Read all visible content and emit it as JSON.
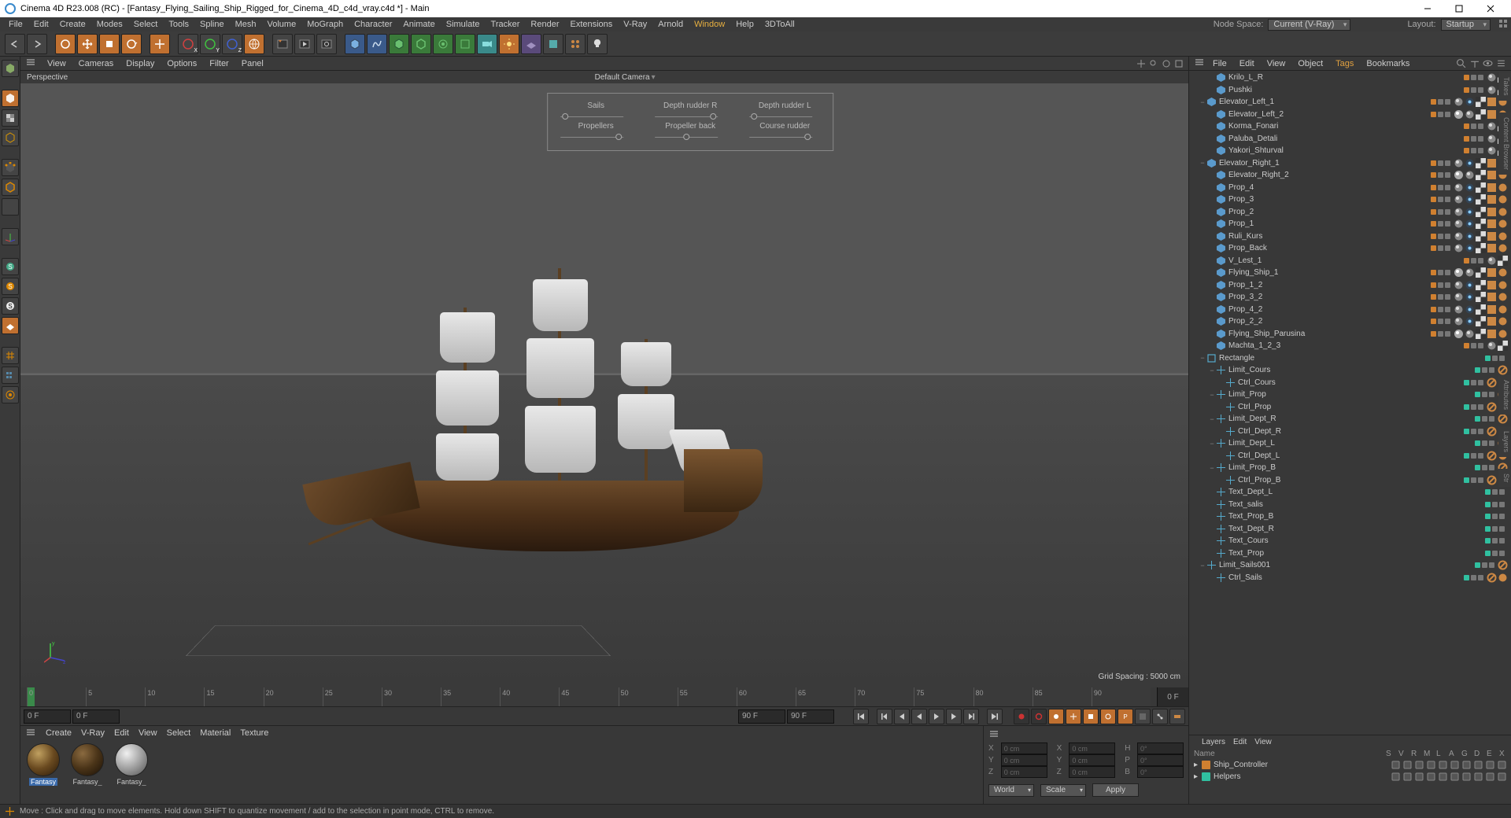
{
  "title": "Cinema 4D R23.008 (RC) - [Fantasy_Flying_Sailing_Ship_Rigged_for_Cinema_4D_c4d_vray.c4d *] - Main",
  "menu": [
    "File",
    "Edit",
    "Create",
    "Modes",
    "Select",
    "Tools",
    "Spline",
    "Mesh",
    "Volume",
    "MoGraph",
    "Character",
    "Animate",
    "Simulate",
    "Tracker",
    "Render",
    "Extensions",
    "V-Ray",
    "Arnold",
    "Window",
    "Help",
    "3DToAll"
  ],
  "menu_highlight": "Window",
  "node_space_label": "Node Space:",
  "node_space_value": "Current (V-Ray)",
  "layout_label": "Layout:",
  "layout_value": "Startup",
  "viewport_menu": [
    "View",
    "Cameras",
    "Display",
    "Options",
    "Filter",
    "Panel"
  ],
  "viewport_label": "Perspective",
  "default_camera": "Default Camera",
  "hud": {
    "row1": [
      "Sails",
      "Depth rudder R",
      "Depth rudder L"
    ],
    "row2": [
      "Propellers",
      "Propeller back",
      "Course rudder"
    ]
  },
  "grid_spacing": "Grid Spacing : 5000 cm",
  "timeline": {
    "start": 0,
    "end": 90,
    "step": 5,
    "current": "0 F",
    "total": "90 F"
  },
  "materials_menu": [
    "Create",
    "V-Ray",
    "Edit",
    "View",
    "Select",
    "Material",
    "Texture"
  ],
  "materials": [
    {
      "name": "Fantasy",
      "sel": true,
      "ball": "b1"
    },
    {
      "name": "Fantasy_",
      "sel": false,
      "ball": "b2"
    },
    {
      "name": "Fantasy_",
      "sel": false,
      "ball": "b3"
    }
  ],
  "coords": {
    "rows": [
      {
        "l1": "X",
        "v1": "0 cm",
        "l2": "X",
        "v2": "0 cm",
        "l3": "H",
        "v3": "0°"
      },
      {
        "l1": "Y",
        "v1": "0 cm",
        "l2": "Y",
        "v2": "0 cm",
        "l3": "P",
        "v3": "0°"
      },
      {
        "l1": "Z",
        "v1": "0 cm",
        "l2": "Z",
        "v2": "0 cm",
        "l3": "B",
        "v3": "0°"
      }
    ],
    "sys": "World",
    "mode": "Scale",
    "apply": "Apply"
  },
  "right_tabs": [
    "File",
    "Edit",
    "View",
    "Object",
    "Tags",
    "Bookmarks"
  ],
  "right_tabs_active": "Tags",
  "objects": [
    {
      "ind": 2,
      "exp": "",
      "icon": "poly",
      "name": "Krilo_L_R",
      "layer": "orange",
      "tags": [
        "phong",
        "checker"
      ]
    },
    {
      "ind": 2,
      "exp": "",
      "icon": "poly",
      "name": "Pushki",
      "layer": "orange",
      "tags": [
        "phong",
        "checker"
      ]
    },
    {
      "ind": 1,
      "exp": "−",
      "icon": "poly",
      "name": "Elevator_Left_1",
      "layer": "orange",
      "tags": [
        "phong",
        "vray",
        "checker",
        "uvw",
        "mat"
      ]
    },
    {
      "ind": 2,
      "exp": "",
      "icon": "poly",
      "name": "Elevator_Left_2",
      "layer": "orange",
      "tags": [
        "ball",
        "phong",
        "checker",
        "uvw",
        "mat"
      ]
    },
    {
      "ind": 2,
      "exp": "",
      "icon": "poly",
      "name": "Korma_Fonari",
      "layer": "orange",
      "tags": [
        "phong",
        "checker"
      ]
    },
    {
      "ind": 2,
      "exp": "",
      "icon": "poly",
      "name": "Paluba_Detali",
      "layer": "orange",
      "tags": [
        "phong",
        "checker"
      ]
    },
    {
      "ind": 2,
      "exp": "",
      "icon": "poly",
      "name": "Yakori_Shturval",
      "layer": "orange",
      "tags": [
        "phong",
        "checker"
      ]
    },
    {
      "ind": 1,
      "exp": "−",
      "icon": "poly",
      "name": "Elevator_Right_1",
      "layer": "orange",
      "tags": [
        "phong",
        "vray",
        "checker",
        "uvw",
        "mat"
      ]
    },
    {
      "ind": 2,
      "exp": "",
      "icon": "poly",
      "name": "Elevator_Right_2",
      "layer": "orange",
      "tags": [
        "ball",
        "phong",
        "checker",
        "uvw",
        "mat"
      ]
    },
    {
      "ind": 2,
      "exp": "",
      "icon": "poly",
      "name": "Prop_4",
      "layer": "orange",
      "tags": [
        "phong",
        "vray",
        "checker",
        "uvw",
        "mat"
      ]
    },
    {
      "ind": 2,
      "exp": "",
      "icon": "poly",
      "name": "Prop_3",
      "layer": "orange",
      "tags": [
        "phong",
        "vray",
        "checker",
        "uvw",
        "mat"
      ]
    },
    {
      "ind": 2,
      "exp": "",
      "icon": "poly",
      "name": "Prop_2",
      "layer": "orange",
      "tags": [
        "phong",
        "vray",
        "checker",
        "uvw",
        "mat"
      ]
    },
    {
      "ind": 2,
      "exp": "",
      "icon": "poly",
      "name": "Prop_1",
      "layer": "orange",
      "tags": [
        "phong",
        "vray",
        "checker",
        "uvw",
        "mat"
      ]
    },
    {
      "ind": 2,
      "exp": "",
      "icon": "poly",
      "name": "Ruli_Kurs",
      "layer": "orange",
      "tags": [
        "phong",
        "vray",
        "checker",
        "uvw",
        "mat"
      ]
    },
    {
      "ind": 2,
      "exp": "",
      "icon": "poly",
      "name": "Prop_Back",
      "layer": "orange",
      "tags": [
        "phong",
        "vray",
        "checker",
        "uvw",
        "mat"
      ]
    },
    {
      "ind": 2,
      "exp": "",
      "icon": "poly",
      "name": "V_Lest_1",
      "layer": "orange",
      "tags": [
        "phong",
        "checker"
      ]
    },
    {
      "ind": 2,
      "exp": "",
      "icon": "poly",
      "name": "Flying_Ship_1",
      "layer": "orange",
      "tags": [
        "ball",
        "phong",
        "checker",
        "uvw",
        "mat"
      ]
    },
    {
      "ind": 2,
      "exp": "",
      "icon": "poly",
      "name": "Prop_1_2",
      "layer": "orange",
      "tags": [
        "phong",
        "vray",
        "checker",
        "uvw",
        "mat"
      ]
    },
    {
      "ind": 2,
      "exp": "",
      "icon": "poly",
      "name": "Prop_3_2",
      "layer": "orange",
      "tags": [
        "phong",
        "vray",
        "checker",
        "uvw",
        "mat"
      ]
    },
    {
      "ind": 2,
      "exp": "",
      "icon": "poly",
      "name": "Prop_4_2",
      "layer": "orange",
      "tags": [
        "phong",
        "vray",
        "checker",
        "uvw",
        "mat"
      ]
    },
    {
      "ind": 2,
      "exp": "",
      "icon": "poly",
      "name": "Prop_2_2",
      "layer": "orange",
      "tags": [
        "phong",
        "vray",
        "checker",
        "uvw",
        "mat"
      ]
    },
    {
      "ind": 2,
      "exp": "",
      "icon": "poly",
      "name": "Flying_Ship_Parusina",
      "layer": "orange",
      "tags": [
        "ball",
        "phong",
        "checker",
        "uvw",
        "mat"
      ]
    },
    {
      "ind": 2,
      "exp": "",
      "icon": "poly",
      "name": "Machta_1_2_3",
      "layer": "orange",
      "tags": [
        "phong",
        "checker"
      ]
    },
    {
      "ind": 1,
      "exp": "−",
      "icon": "spline",
      "name": "Rectangle",
      "layer": "teal",
      "tags": []
    },
    {
      "ind": 2,
      "exp": "−",
      "icon": "null",
      "name": "Limit_Cours",
      "layer": "teal",
      "tags": [
        "constraint"
      ]
    },
    {
      "ind": 3,
      "exp": "",
      "icon": "null",
      "name": "Ctrl_Cours",
      "layer": "teal",
      "tags": [
        "constraint",
        "mat"
      ]
    },
    {
      "ind": 2,
      "exp": "−",
      "icon": "null",
      "name": "Limit_Prop",
      "layer": "teal",
      "tags": [
        "constraint"
      ]
    },
    {
      "ind": 3,
      "exp": "",
      "icon": "null",
      "name": "Ctrl_Prop",
      "layer": "teal",
      "tags": [
        "constraint",
        "mat"
      ]
    },
    {
      "ind": 2,
      "exp": "−",
      "icon": "null",
      "name": "Limit_Dept_R",
      "layer": "teal",
      "tags": [
        "constraint"
      ]
    },
    {
      "ind": 3,
      "exp": "",
      "icon": "null",
      "name": "Ctrl_Dept_R",
      "layer": "teal",
      "tags": [
        "constraint",
        "mat"
      ]
    },
    {
      "ind": 2,
      "exp": "−",
      "icon": "null",
      "name": "Limit_Dept_L",
      "layer": "teal",
      "tags": [
        "constraint"
      ]
    },
    {
      "ind": 3,
      "exp": "",
      "icon": "null",
      "name": "Ctrl_Dept_L",
      "layer": "teal",
      "tags": [
        "constraint",
        "mat"
      ]
    },
    {
      "ind": 2,
      "exp": "−",
      "icon": "null",
      "name": "Limit_Prop_B",
      "layer": "teal",
      "tags": [
        "constraint"
      ]
    },
    {
      "ind": 3,
      "exp": "",
      "icon": "null",
      "name": "Ctrl_Prop_B",
      "layer": "teal",
      "tags": [
        "constraint",
        "mat"
      ]
    },
    {
      "ind": 2,
      "exp": "",
      "icon": "null",
      "name": "Text_Dept_L",
      "layer": "teal",
      "tags": []
    },
    {
      "ind": 2,
      "exp": "",
      "icon": "null",
      "name": "Text_salis",
      "layer": "teal",
      "tags": []
    },
    {
      "ind": 2,
      "exp": "",
      "icon": "null",
      "name": "Text_Prop_B",
      "layer": "teal",
      "tags": []
    },
    {
      "ind": 2,
      "exp": "",
      "icon": "null",
      "name": "Text_Dept_R",
      "layer": "teal",
      "tags": []
    },
    {
      "ind": 2,
      "exp": "",
      "icon": "null",
      "name": "Text_Cours",
      "layer": "teal",
      "tags": []
    },
    {
      "ind": 2,
      "exp": "",
      "icon": "null",
      "name": "Text_Prop",
      "layer": "teal",
      "tags": []
    },
    {
      "ind": 1,
      "exp": "−",
      "icon": "null",
      "name": "Limit_Sails001",
      "layer": "teal",
      "tags": [
        "constraint"
      ]
    },
    {
      "ind": 2,
      "exp": "",
      "icon": "null",
      "name": "Ctrl_Sails",
      "layer": "teal",
      "tags": [
        "constraint",
        "mat"
      ]
    }
  ],
  "layers_tabs": [
    "Layers",
    "Edit",
    "View"
  ],
  "layers_cols": [
    "S",
    "V",
    "R",
    "M",
    "L",
    "A",
    "G",
    "D",
    "E",
    "X"
  ],
  "layers": [
    {
      "name": "Ship_Controller",
      "color": "#d08030"
    },
    {
      "name": "Helpers",
      "color": "#30c0a0"
    }
  ],
  "layers_header": "Name",
  "status": "Move : Click and drag to move elements. Hold down SHIFT to quantize movement / add to the selection in point mode, CTRL to remove.",
  "side_tabs": [
    "Takes",
    "Content Browser",
    "Attributes",
    "Layers",
    "Str"
  ]
}
